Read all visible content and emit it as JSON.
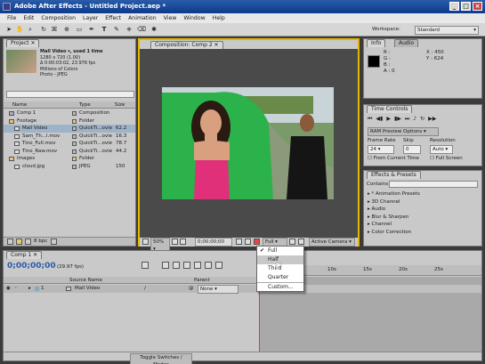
{
  "window": {
    "title": "Adobe After Effects - Untitled Project.aep *"
  },
  "menu": [
    "File",
    "Edit",
    "Composition",
    "Layer",
    "Effect",
    "Animation",
    "View",
    "Window",
    "Help"
  ],
  "toolbar": {
    "workspace_label": "Workspace:",
    "workspace_value": "Standard"
  },
  "project": {
    "tab": "Project",
    "footage_name": "Mall Video ▾, used 1 time",
    "footage_info": [
      "1280 x 720 (1.00)",
      "Δ 0:00:03:02, 23.976 fps",
      "Millions of Colors",
      "Photo - JPEG"
    ],
    "columns": {
      "name": "Name",
      "type": "Type",
      "size": "Size"
    },
    "items": [
      {
        "name": "Comp 1",
        "type": "Composition",
        "size": "",
        "indent": 0,
        "kind": "comp"
      },
      {
        "name": "Footage",
        "type": "Folder",
        "size": "",
        "indent": 0,
        "kind": "folder"
      },
      {
        "name": "Mall Video",
        "type": "QuickTi...ovie",
        "size": "62.2",
        "indent": 1,
        "kind": "file"
      },
      {
        "name": "Sam_Th...l.mov",
        "type": "QuickTi...ovie",
        "size": "16.3",
        "indent": 1,
        "kind": "file"
      },
      {
        "name": "Tino_Full.mov",
        "type": "QuickTi...ovie",
        "size": "78.7",
        "indent": 1,
        "kind": "file"
      },
      {
        "name": "Tino_Raw.mov",
        "type": "QuickTi...ovie",
        "size": "44.2",
        "indent": 1,
        "kind": "file"
      },
      {
        "name": "Images",
        "type": "Folder",
        "size": "",
        "indent": 0,
        "kind": "folder"
      },
      {
        "name": "cloud.jpg",
        "type": "JPEG",
        "size": "150",
        "indent": 1,
        "kind": "file"
      }
    ],
    "bpc": "8 bpc"
  },
  "composition": {
    "tab": "Composition: Comp 2",
    "zoom": "50%",
    "timecode": "0;00;00;00",
    "resolution": "Full",
    "camera": "Active Camera"
  },
  "info": {
    "tabs": [
      "Info",
      "Audio"
    ],
    "r": "R :",
    "g": "G :",
    "b": "B :",
    "a": "A : 0",
    "x": "X : 450",
    "y": "Y : 624"
  },
  "time_controls": {
    "tab": "Time Controls",
    "ram_preview": "RAM Preview Options",
    "frame_rate_label": "Frame Rate",
    "skip_label": "Skip",
    "resolution_label": "Resolution",
    "frame_rate": "24",
    "skip": "0",
    "resolution": "Auto",
    "from_current": "From Current Time",
    "full_screen": "Full Screen"
  },
  "effects": {
    "tab": "Effects & Presets",
    "contains": "Contains:",
    "items": [
      "* Animation Presets",
      "3D Channel",
      "Audio",
      "Blur & Sharpen",
      "Channel",
      "Color Correction"
    ]
  },
  "timeline": {
    "tab": "Comp 1",
    "timecode": "0;00;00;00",
    "fps": "(29.97 fps)",
    "cols": {
      "source": "Source Name",
      "parent": "Parent"
    },
    "layer_num": "1",
    "layer_name": "Mall Video",
    "parent_value": "None",
    "ruler": [
      "0s",
      "10s",
      "15s",
      "20s",
      "25s"
    ],
    "toggle": "Toggle Switches / Modes"
  },
  "resolution_menu": {
    "items": [
      "Full",
      "Half",
      "Third",
      "Quarter",
      "Custom..."
    ],
    "checked": "Full",
    "hover": "Half"
  }
}
